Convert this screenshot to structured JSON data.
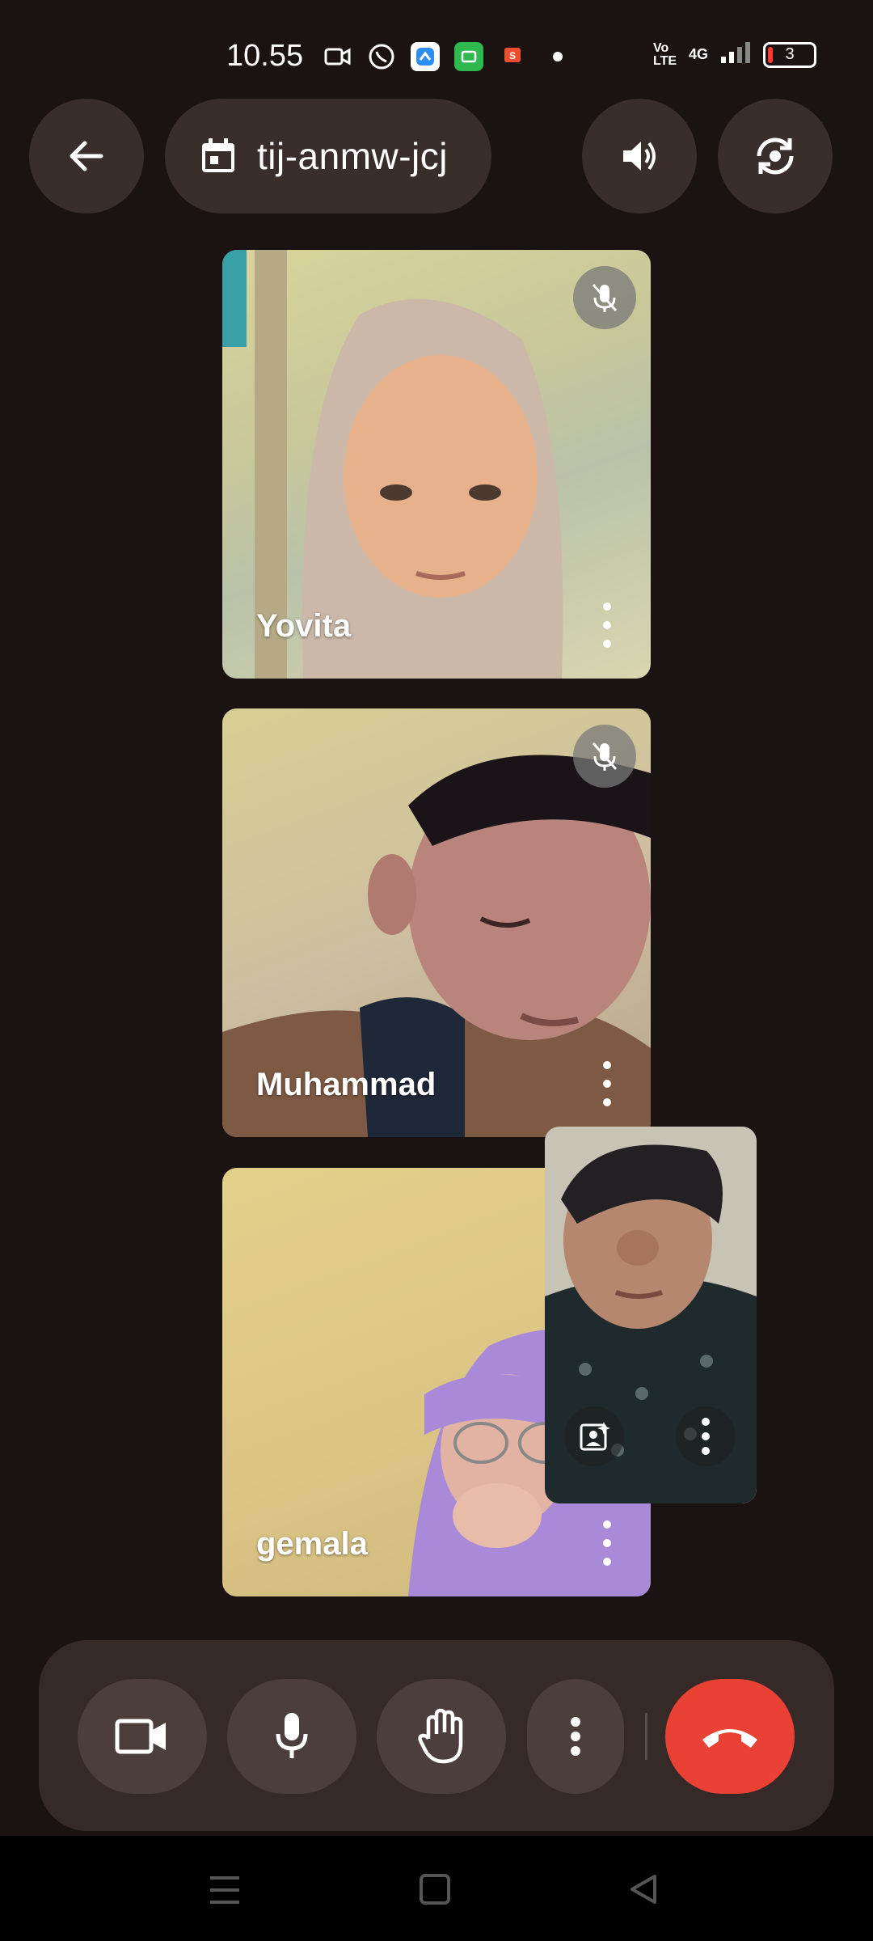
{
  "status_bar": {
    "time": "10.55",
    "app_icons": [
      "video-icon",
      "whatsapp-icon",
      "messenger-icon",
      "wallet-icon",
      "shopee-pay-icon"
    ],
    "volte": "Vo LTE",
    "network": "4G",
    "battery_level": "3"
  },
  "top_bar": {
    "meeting_code": "tij-anmw-jcj",
    "icons": [
      "back-arrow-icon",
      "calendar-icon",
      "speaker-icon",
      "switch-camera-icon"
    ]
  },
  "participants": [
    {
      "name": "Yovita",
      "muted": true
    },
    {
      "name": "Muhammad",
      "muted": true
    },
    {
      "name": "gemala",
      "muted": false
    }
  ],
  "self_view": {
    "icons": [
      "effects-icon",
      "more-vert-icon"
    ]
  },
  "controls": {
    "buttons": [
      "camera-icon",
      "microphone-icon",
      "raise-hand-icon",
      "more-vert-icon",
      "end-call-icon"
    ],
    "end_call_color": "#e94235"
  },
  "navigation": {
    "icons": [
      "recents-icon",
      "home-icon",
      "back-triangle-icon"
    ]
  },
  "colors": {
    "background": "#1b1212",
    "button": "#3a2e2d",
    "control_bar": "#362a29"
  }
}
